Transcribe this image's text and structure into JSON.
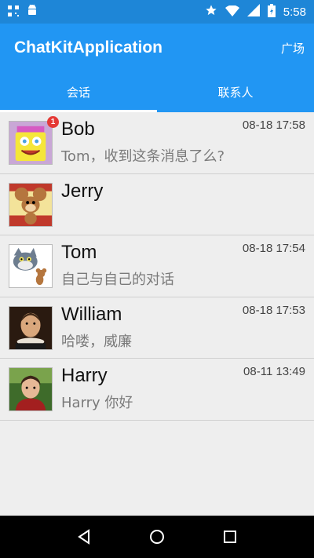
{
  "status_bar": {
    "time": "5:58",
    "icons": [
      "qr-icon",
      "android-icon",
      "star-icon",
      "wifi-icon",
      "signal-icon",
      "battery-icon"
    ]
  },
  "app_bar": {
    "title": "ChatKitApplication",
    "action": "广场"
  },
  "tabs": [
    {
      "label": "会话",
      "active": true
    },
    {
      "label": "联系人",
      "active": false
    }
  ],
  "conversations": [
    {
      "name": "Bob",
      "time": "08-18 17:58",
      "message": "Tom，收到这条消息了么?",
      "unread": "1",
      "avatar": "spongebob-avatar"
    },
    {
      "name": "Jerry",
      "time": "",
      "message": "",
      "unread": "",
      "avatar": "jerry-avatar"
    },
    {
      "name": "Tom",
      "time": "08-18 17:54",
      "message": "自己与自己的对话",
      "unread": "",
      "avatar": "tom-avatar"
    },
    {
      "name": "William",
      "time": "08-18 17:53",
      "message": "哈喽，威廉",
      "unread": "",
      "avatar": "william-avatar"
    },
    {
      "name": "Harry",
      "time": "08-11 13:49",
      "message": "Harry 你好",
      "unread": "",
      "avatar": "harry-avatar"
    }
  ],
  "nav_bar": {
    "buttons": [
      "back-icon",
      "home-icon",
      "recents-icon"
    ]
  },
  "colors": {
    "primary": "#2196f3",
    "status_bar": "#1e86d7",
    "badge": "#e53935",
    "background": "#eeeeee"
  }
}
